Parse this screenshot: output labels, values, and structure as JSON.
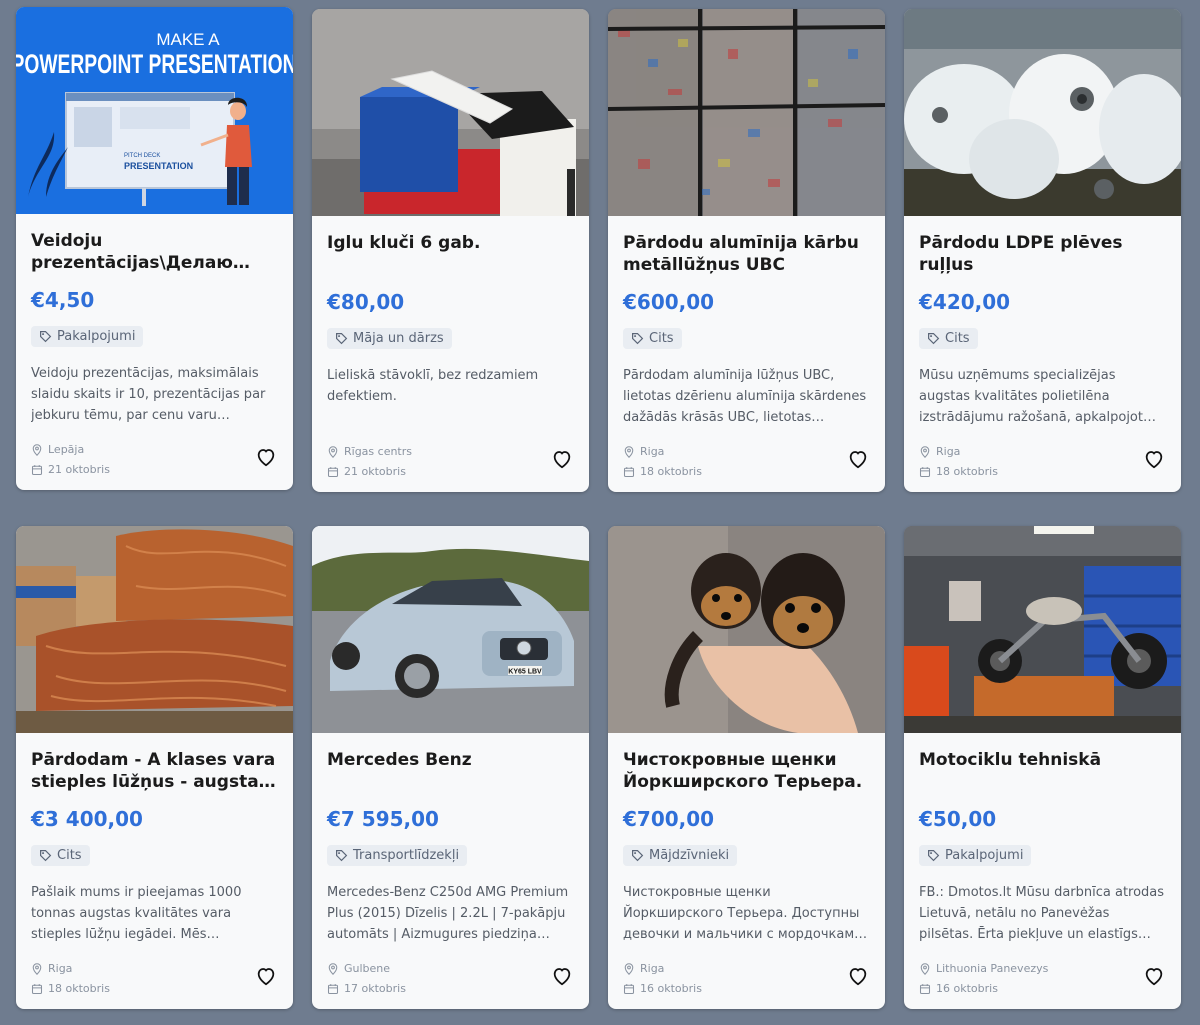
{
  "listings": [
    {
      "title": "Veidoju prezentācijas\\Делаю презентации",
      "price": "€4,50",
      "category": "Pakalpojumi",
      "description": "Veidoju prezentācijas, maksimālais slaidu skaits ir 10, prezentācijas par jebkuru tēmu, par cenu varu vienoties.",
      "location": "Lepāja",
      "date": "21 oktobris",
      "image_text": [
        "MAKE A",
        "POWERPOINT PRESENTATION",
        "PITCH DECK",
        "PRESENTATION"
      ]
    },
    {
      "title": "Iglu kluči 6 gab.",
      "price": "€80,00",
      "category": "Māja un dārzs",
      "description": "Lieliskā stāvoklī, bez redzamiem defektiem.",
      "location": "Rīgas centrs",
      "date": "21 oktobris"
    },
    {
      "title": "Pārdodu alumīnija kārbu metāllūžņus UBC",
      "price": "€600,00",
      "category": "Cits",
      "description": "Pārdodam alumīnija lūžņus UBC, lietotas dzērienu alumīnija skārdenes dažādās krāsās UBC, lietotas dzērienu skārdenes.",
      "location": "Riga",
      "date": "18 oktobris"
    },
    {
      "title": "Pārdodu LDPE plēves ruļļus",
      "price": "€420,00",
      "category": "Cits",
      "description": "Mūsu uzņēmums specializējas augstas kvalitātes polietilēna izstrādājumu ražošanā, apkalpojot klientus.",
      "location": "Riga",
      "date": "18 oktobris"
    },
    {
      "title": "Pārdodam - A klases vara stieples lūžņus - augstas kvalitātes",
      "price": "€3 400,00",
      "category": "Cits",
      "description": "Pašlaik mums ir pieejamas 1000 tonnas augstas kvalitātes vara stieples lūžņu iegādei. Mēs piedāvājam konkurētspējīgas cenas.",
      "location": "Riga",
      "date": "18 oktobris"
    },
    {
      "title": "Mercedes Benz",
      "price": "€7 595,00",
      "category": "Transportlīdzekļi",
      "description": "Mercedes-Benz C250d AMG Premium Plus (2015) Dīzelis | 2.2L | 7-pakāpju automāts | Aizmugures piedziņa Automašīna.",
      "location": "Gulbene",
      "date": "17 oktobris",
      "image_text": [
        "KY65 LBV"
      ]
    },
    {
      "title": "Чистокровные щенки Йоркширского Терьера.",
      "price": "€700,00",
      "category": "Mājdzīvnieki",
      "description": "Чистокровные щенки Йоркширского Терьера. Доступны девочки и мальчики с мордочками беби-фейс с документами.",
      "location": "Riga",
      "date": "16 oktobris"
    },
    {
      "title": "Motociklu tehniskā",
      "price": "€50,00",
      "category": "Pakalpojumi",
      "description": "FB.: Dmotos.lt Mūsu darbnīca atrodas Lietuvā, netālu no Panevėžas pilsētas. Ērta piekļuve un elastīgs darba laiks. Sazinieties.",
      "location": "Lithuonia Panevezys",
      "date": "16 oktobris"
    }
  ],
  "colors": {
    "page_bg": "#6f7c8f",
    "card_bg": "#f8f9fa",
    "price": "#2f6fd8",
    "tag_bg": "#e9edf2"
  },
  "icons": {
    "tag": "tag-icon",
    "location": "map-pin-icon",
    "date": "calendar-icon",
    "favorite": "heart-icon"
  }
}
